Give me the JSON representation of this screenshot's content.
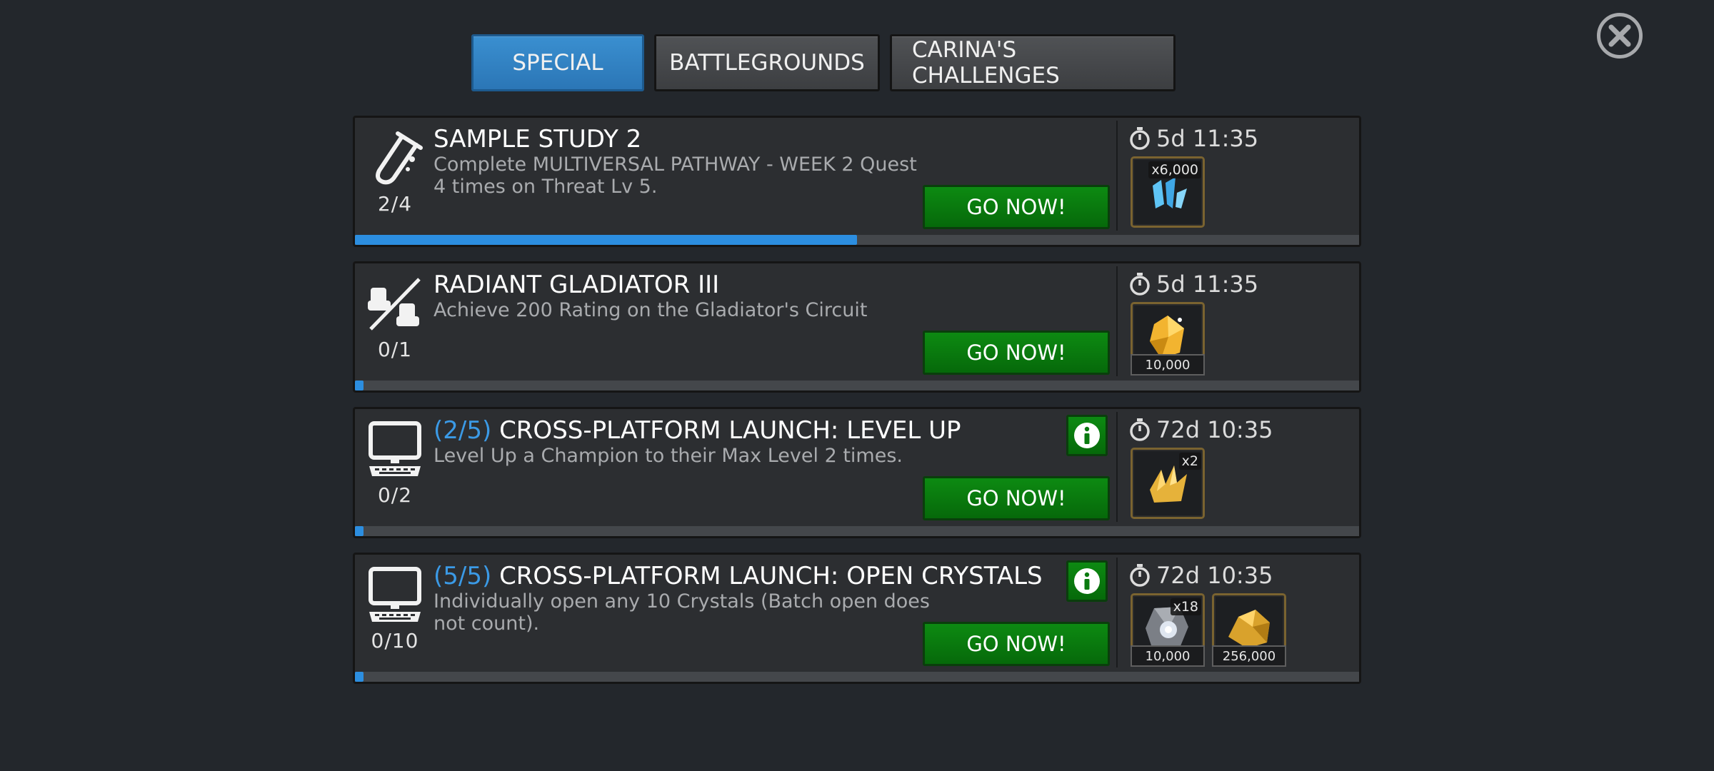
{
  "tabs": [
    {
      "label": "SPECIAL",
      "active": true
    },
    {
      "label": "BATTLEGROUNDS",
      "active": false
    },
    {
      "label": "CARINA'S CHALLENGES",
      "active": false
    }
  ],
  "close_icon": "close-icon",
  "accent_color": "#2c8ee0",
  "button_color": "#0d8a12",
  "quests": [
    {
      "icon": "test-tube-icon",
      "count": "2/4",
      "title_prefix": "",
      "title": "SAMPLE STUDY 2",
      "desc": "Complete MULTIVERSAL PATHWAY - WEEK 2 Quest 4 times on Threat Lv 5.",
      "button": "GO NOW!",
      "has_info": false,
      "timer": "5d 11:35",
      "progress": 0.5,
      "rewards": [
        {
          "icon": "blue-shards-icon",
          "qty": "x6,000",
          "amount": ""
        }
      ]
    },
    {
      "icon": "gladiator-icon",
      "count": "0/1",
      "title_prefix": "",
      "title": "RADIANT GLADIATOR III",
      "desc": "Achieve 200 Rating on the Gladiator's Circuit",
      "button": "GO NOW!",
      "has_info": false,
      "timer": "5d 11:35",
      "progress": 0.0,
      "rewards": [
        {
          "icon": "gold-gem-icon",
          "qty": "",
          "amount": "10,000"
        }
      ]
    },
    {
      "icon": "computer-icon",
      "count": "0/2",
      "title_prefix": "(2/5)",
      "title": "CROSS-PLATFORM LAUNCH: LEVEL UP",
      "desc": "Level Up a Champion to their Max Level 2 times.",
      "button": "GO NOW!",
      "has_info": true,
      "timer": "72d 10:35",
      "progress": 0.0,
      "rewards": [
        {
          "icon": "gold-shards-icon",
          "qty": "x2",
          "amount": ""
        }
      ]
    },
    {
      "icon": "computer-icon",
      "count": "0/10",
      "title_prefix": "(5/5)",
      "title": "CROSS-PLATFORM LAUNCH: OPEN CRYSTALS",
      "desc": "Individually open any 10 Crystals (Batch open does not count).",
      "button": "GO NOW!",
      "has_info": true,
      "timer": "72d 10:35",
      "progress": 0.0,
      "rewards": [
        {
          "icon": "silver-crystal-icon",
          "qty": "x18",
          "amount": "10,000"
        },
        {
          "icon": "gold-nugget-icon",
          "qty": "",
          "amount": "256,000"
        }
      ]
    }
  ]
}
